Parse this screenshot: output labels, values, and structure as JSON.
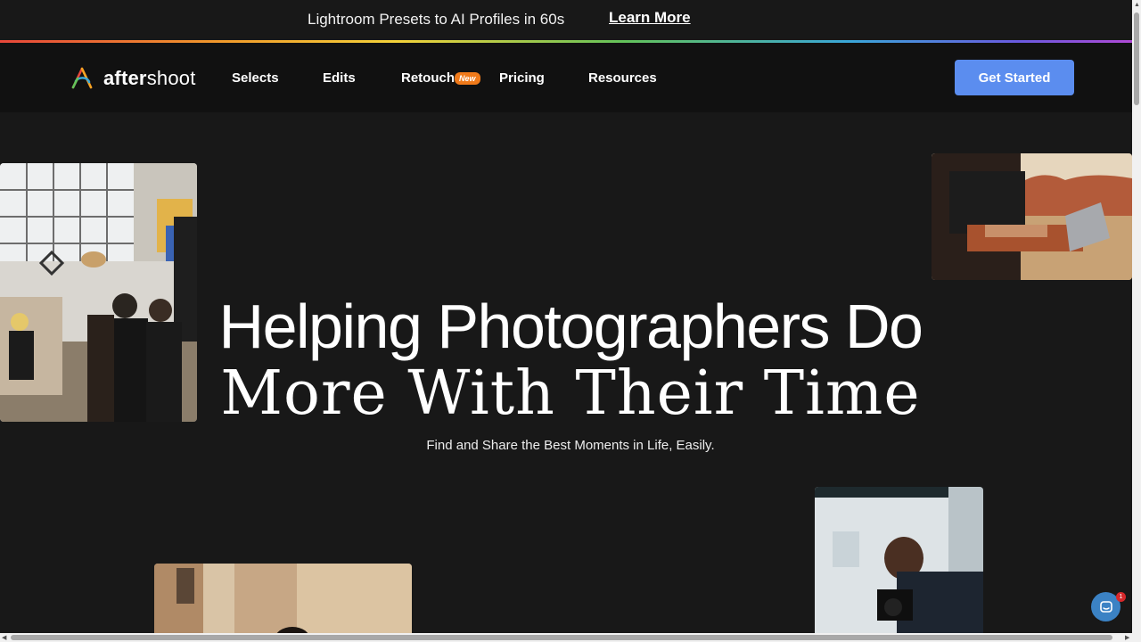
{
  "announcement": {
    "text": "Lightroom Presets to AI Profiles in 60s",
    "link_label": "Learn More"
  },
  "nav": {
    "brand": {
      "prefix": "after",
      "suffix": "shoot"
    },
    "items": [
      {
        "label": "Selects"
      },
      {
        "label": "Edits"
      },
      {
        "label": "Retouch",
        "badge": "New"
      },
      {
        "label": "Pricing"
      },
      {
        "label": "Resources"
      }
    ],
    "cta_label": "Get Started"
  },
  "hero": {
    "line1": "Helping Photographers Do",
    "line2": "More With Their Time",
    "subtitle": "Find and Share the Best Moments in Life, Easily."
  },
  "chat_widget": {
    "unread_count": "1"
  },
  "colors": {
    "background": "#181818",
    "nav_background": "#111111",
    "cta": "#5b8def",
    "badge": "#f07a1a",
    "chat": "#3b82c4"
  }
}
